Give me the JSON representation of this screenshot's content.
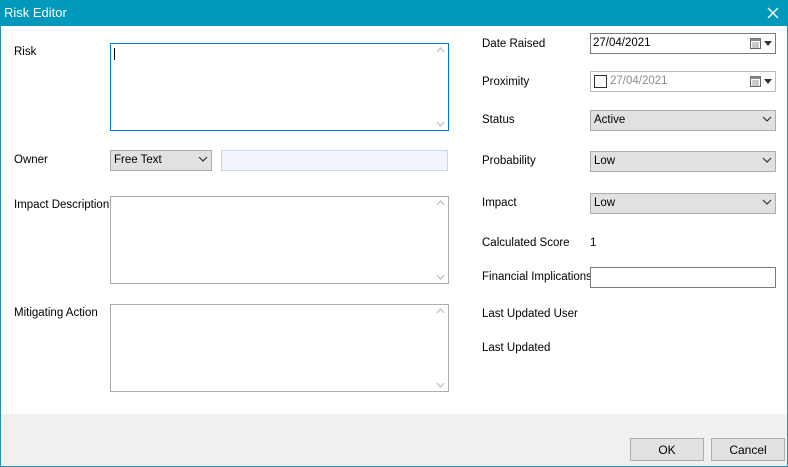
{
  "window": {
    "title": "Risk Editor"
  },
  "left": {
    "risk_label": "Risk",
    "owner_label": "Owner",
    "owner_type": "Free Text",
    "owner_text": "",
    "impact_description_label": "Impact Description",
    "mitigating_action_label": "Mitigating Action"
  },
  "right": {
    "date_raised_label": "Date Raised",
    "date_raised_value": "27/04/2021",
    "proximity_label": "Proximity",
    "proximity_value": "27/04/2021",
    "proximity_checked": false,
    "status_label": "Status",
    "status_value": "Active",
    "probability_label": "Probability",
    "probability_value": "Low",
    "impact_label": "Impact",
    "impact_value": "Low",
    "calculated_score_label": "Calculated Score",
    "calculated_score_value": "1",
    "financial_implications_label": "Financial Implications",
    "financial_implications_value": "",
    "last_updated_user_label": "Last Updated User",
    "last_updated_user_value": "",
    "last_updated_label": "Last Updated",
    "last_updated_value": ""
  },
  "footer": {
    "ok_label": "OK",
    "cancel_label": "Cancel"
  },
  "icons": {
    "close": "close-icon",
    "calendar": "calendar-icon",
    "dropdown": "chevron-down-icon",
    "scroll_up": "scroll-up-arrow-icon",
    "scroll_down": "scroll-down-arrow-icon"
  },
  "colors": {
    "titlebar": "#0099bc",
    "focus_border": "#0078d7"
  }
}
